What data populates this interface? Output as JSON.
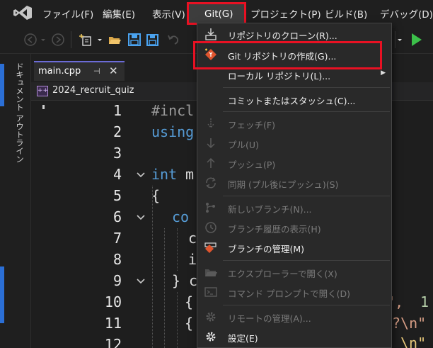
{
  "menubar": {
    "items": [
      "ファイル(F)",
      "編集(E)",
      "表示(V)",
      "Git(G)",
      "プロジェクト(P)",
      "ビルド(B)",
      "デバッグ(D)"
    ]
  },
  "sidepanel": {
    "doc_outline_label": "ドキュメント アウトライン"
  },
  "tabs": {
    "active_file": "main.cpp",
    "pin_glyph": "⊣",
    "close_glyph": "✕"
  },
  "navbar": {
    "project_name": "2024_recruit_quiz",
    "project_icon_text": "++"
  },
  "editor": {
    "line_numbers": [
      "1",
      "2",
      "3",
      "4",
      "5",
      "6",
      "7",
      "8",
      "9",
      "10",
      "11",
      "12"
    ],
    "lines": {
      "l1_directive": "#incl",
      "l2_keyword": "using",
      "l4_keyword": "int",
      "l4_rest": " m",
      "l5": "{",
      "l6": "co",
      "l7": "c",
      "l8": "i",
      "l9_brace": "}",
      "l9_rest": " c",
      "l10_brace": "{",
      "l10_tail_str": "n\",",
      "l10_tail_num": " 1",
      "l11_brace": "{",
      "l11_tail_str": "?\\n\"",
      "l12_tail": "\\n\""
    }
  },
  "git_menu": {
    "items": [
      {
        "label": "リポジトリのクローン(R)...",
        "icon": "clone-icon",
        "enabled": true
      },
      {
        "label": "Git リポジトリの作成(G)...",
        "icon": "create-repo-icon",
        "enabled": true,
        "highlighted": true
      },
      {
        "label": "ローカル リポジトリ(L)...",
        "icon": "",
        "enabled": true,
        "submenu": true
      },
      {
        "label": "コミットまたはスタッシュ(C)...",
        "icon": "",
        "enabled": true
      },
      {
        "label": "フェッチ(F)",
        "icon": "fetch-icon",
        "enabled": false
      },
      {
        "label": "プル(U)",
        "icon": "pull-icon",
        "enabled": false
      },
      {
        "label": "プッシュ(P)",
        "icon": "push-icon",
        "enabled": false
      },
      {
        "label": "同期 (プル後にプッシュ)(S)",
        "icon": "sync-icon",
        "enabled": false
      },
      {
        "label": "新しいブランチ(N)...",
        "icon": "new-branch-icon",
        "enabled": false
      },
      {
        "label": "ブランチ履歴の表示(H)",
        "icon": "branch-history-icon",
        "enabled": false
      },
      {
        "label": "ブランチの管理(M)",
        "icon": "manage-branches-icon",
        "enabled": true
      },
      {
        "label": "エクスプローラーで開く(X)",
        "icon": "folder-icon",
        "enabled": false
      },
      {
        "label": "コマンド プロンプトで開く(D)",
        "icon": "terminal-icon",
        "enabled": false
      },
      {
        "label": "リモートの管理(A)...",
        "icon": "gear-icon",
        "enabled": false
      },
      {
        "label": "設定(E)",
        "icon": "gear-icon",
        "enabled": true
      }
    ]
  },
  "colors": {
    "highlight_box": "#e81123",
    "keyword": "#569cd6",
    "run_green": "#3cc04a",
    "menu_bg": "#292929"
  }
}
